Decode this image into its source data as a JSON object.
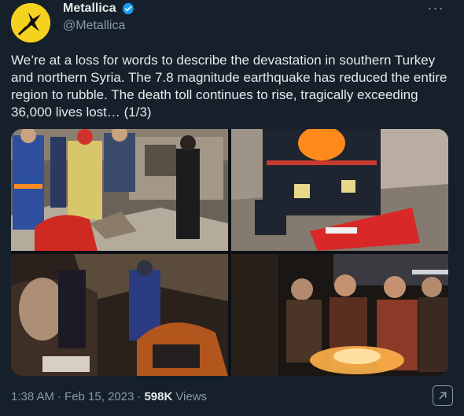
{
  "account": {
    "display_name": "Metallica",
    "handle": "@Metallica",
    "verified": true,
    "avatar_icon": "ninja-star-logo-icon",
    "avatar_color": "#f4d21f"
  },
  "tweet": {
    "text": "We’re at a loss for words to describe the devastation in southern Turkey and northern Syria. The 7.8 magnitude earthquake has reduced the entire region to rubble. The death toll continues to rise, tragically exceeding 36,000 lives lost… (1/3)"
  },
  "media": {
    "photos": [
      {
        "alt": "rescue-workers-in-rubble"
      },
      {
        "alt": "rescuer-with-orange-helmet"
      },
      {
        "alt": "night-rescue-operation"
      },
      {
        "alt": "people-warming-by-fire"
      }
    ]
  },
  "meta": {
    "time": "1:38 AM",
    "separator": "·",
    "date": "Feb 15, 2023",
    "separator2": "·",
    "views_count": "598K",
    "views_label": "Views"
  },
  "icons": {
    "more": "more-options-icon",
    "verified": "verified-badge-icon",
    "expand": "expand-icon"
  },
  "colors": {
    "background": "#15202b",
    "text": "#e7e9ea",
    "muted": "#8b98a5",
    "verified": "#1d9bf0"
  }
}
